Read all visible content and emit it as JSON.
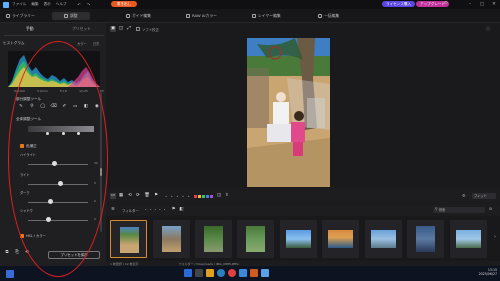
{
  "menubar": {
    "items": [
      "ファイル",
      "編集",
      "表示",
      "ヘルプ"
    ],
    "save_label": "書き出し",
    "buy_label": "ライセンス購入",
    "upgrade_label": "アップグレード"
  },
  "modebar": {
    "left_tabs": [
      "ライブラリー",
      "調整"
    ],
    "tabs": [
      "ガイド編集",
      "RAW AIカラー",
      "レイヤー編集",
      "一括編集"
    ]
  },
  "left_panel": {
    "subtabs": [
      "手動",
      "プリセット"
    ],
    "histogram_label": "ヒストグラム",
    "histogram_toggle": "カラー",
    "histogram_extra": "白黒",
    "histogram_ticks": [
      "ISO100",
      "5.0mm",
      "f/1.8",
      "1/125",
      "EV"
    ],
    "tools_label": "部分調整ツール",
    "global_label": "全体調整ツール",
    "color_section": "色補正",
    "sliders": [
      {
        "name": "ハイライト",
        "value": 30
      },
      {
        "name": "ライト",
        "value": 0
      },
      {
        "name": "ダーク",
        "value": 0
      },
      {
        "name": "シャドウ",
        "value": 0
      }
    ],
    "hsl_label": "HSL / カラー",
    "apply_button": "プリセットを保存"
  },
  "canvas": {
    "toolbar_label": "ソフト校正",
    "zoom": "フィット"
  },
  "filmstrip": {
    "filter_label": "フィルター",
    "search_placeholder": "検索",
    "thumb_count": 10
  },
  "status": {
    "text": "1 枚選択 / 12 枚表示",
    "path": "フォルダー / Downloads / IMG_0885.JPEG"
  },
  "taskbar": {
    "time": "13:15",
    "date": "2025/06/27"
  },
  "colors": {
    "accent_orange": "#e85a22",
    "accent_purple": "#5a46e6",
    "annotation_red": "#e02020"
  }
}
